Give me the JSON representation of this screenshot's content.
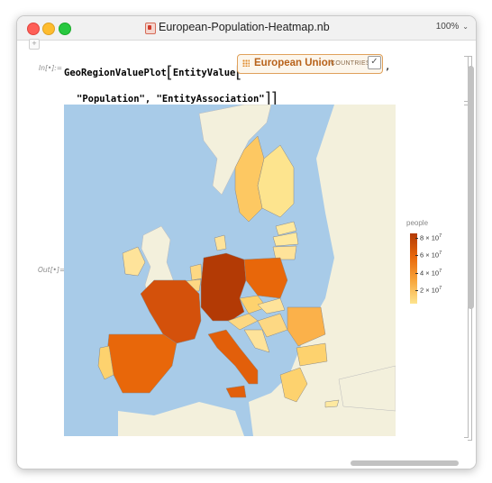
{
  "window": {
    "title": "European-Population-Heatmap.nb",
    "zoom": "100%"
  },
  "cell": {
    "input_label": "In[•]:=",
    "output_label": "Out[•]=",
    "func": "GeoRegionValuePlot",
    "inner_func": "EntityValue",
    "entity_name": "European Union",
    "entity_type": "COUNTRIES",
    "entity_check": "✓",
    "arg2": "\"Population\", \"EntityAssociation\"",
    "comma": ","
  },
  "legend": {
    "title": "people",
    "ticks": [
      {
        "mant": "8 × 10",
        "exp": "7"
      },
      {
        "mant": "6 × 10",
        "exp": "7"
      },
      {
        "mant": "4 × 10",
        "exp": "7"
      },
      {
        "mant": "2 × 10",
        "exp": "7"
      }
    ]
  },
  "colors": {
    "sea": "#a8cbe8",
    "land": "#f3f0dc",
    "scale_high": "#b33a05",
    "scale_mid_high": "#e8670a",
    "scale_mid_low": "#f8a53a",
    "scale_low": "#fde48e"
  }
}
